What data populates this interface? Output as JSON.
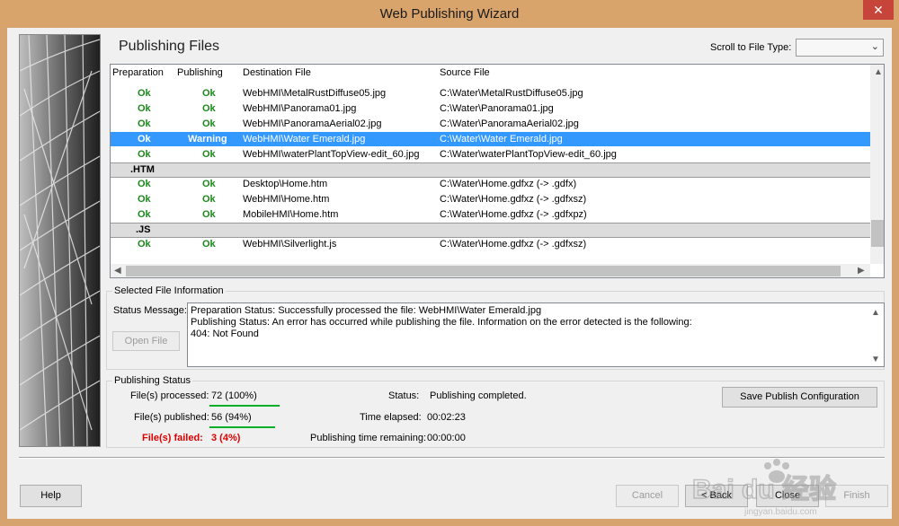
{
  "window": {
    "title": "Web Publishing Wizard",
    "close_glyph": "✕"
  },
  "page": {
    "heading": "Publishing Files"
  },
  "filter": {
    "label": "Scroll to File Type:",
    "value": ""
  },
  "columns": [
    "Preparation",
    "Publishing",
    "Destination File",
    "Source File"
  ],
  "rows": [
    {
      "prep": "Ok",
      "pub": "Ok",
      "dest": "WebHMI\\MetalRustDiffuse05.jpg",
      "src": "C:\\Water\\MetalRustDiffuse05.jpg"
    },
    {
      "prep": "Ok",
      "pub": "Ok",
      "dest": "WebHMI\\Panorama01.jpg",
      "src": "C:\\Water\\Panorama01.jpg"
    },
    {
      "prep": "Ok",
      "pub": "Ok",
      "dest": "WebHMI\\PanoramaAerial02.jpg",
      "src": "C:\\Water\\PanoramaAerial02.jpg"
    },
    {
      "prep": "Ok",
      "pub": "Warning",
      "dest": "WebHMI\\Water Emerald.jpg",
      "src": "C:\\Water\\Water Emerald.jpg",
      "selected": true
    },
    {
      "prep": "Ok",
      "pub": "Ok",
      "dest": "WebHMI\\waterPlantTopView-edit_60.jpg",
      "src": "C:\\Water\\waterPlantTopView-edit_60.jpg"
    }
  ],
  "group_htm": {
    "label": ".HTM"
  },
  "rows_htm": [
    {
      "prep": "Ok",
      "pub": "Ok",
      "dest": "Desktop\\Home.htm",
      "src": "C:\\Water\\Home.gdfxz (-> .gdfx)"
    },
    {
      "prep": "Ok",
      "pub": "Ok",
      "dest": "WebHMI\\Home.htm",
      "src": "C:\\Water\\Home.gdfxz (-> .gdfxsz)"
    },
    {
      "prep": "Ok",
      "pub": "Ok",
      "dest": "MobileHMI\\Home.htm",
      "src": "C:\\Water\\Home.gdfxz (-> .gdfxpz)"
    }
  ],
  "group_js": {
    "label": ".JS"
  },
  "rows_js": [
    {
      "prep": "Ok",
      "pub": "Ok",
      "dest": "WebHMI\\Silverlight.js",
      "src": "C:\\Water\\Home.gdfxz (-> .gdfxsz)"
    }
  ],
  "selected_info": {
    "title": "Selected File Information",
    "status_label": "Status Message:",
    "message_lines": [
      "Preparation Status: Successfully processed the file: WebHMI\\Water Emerald.jpg",
      "Publishing Status: An error has occurred while publishing the file. Information on the error detected is the following:",
      "404: Not Found"
    ],
    "open_file_label": "Open File"
  },
  "publishing_status": {
    "title": "Publishing Status",
    "processed_label": "File(s) processed:",
    "processed_value": "72 (100%)",
    "processed_fraction": 1.0,
    "published_label": "File(s) published:",
    "published_value": "56 (94%)",
    "published_fraction": 0.94,
    "failed_label": "File(s) failed:",
    "failed_value": "3 (4%)",
    "status_label": "Status:",
    "status_value": "Publishing completed.",
    "elapsed_label": "Time elapsed:",
    "elapsed_value": "00:02:23",
    "remaining_label": "Publishing time remaining:",
    "remaining_value": "00:00:00",
    "save_config_label": "Save Publish Configuration"
  },
  "footer": {
    "help": "Help",
    "cancel": "Cancel",
    "back": "< Back",
    "close": "Close",
    "finish": "Finish"
  },
  "colors": {
    "ok": "#1a8a1a",
    "failed": "#e00000",
    "selection": "#3399ff",
    "titlebar": "#d9a46c"
  },
  "watermark": {
    "text": "Bai du 经验",
    "sub": "jingyan.baidu.com"
  }
}
